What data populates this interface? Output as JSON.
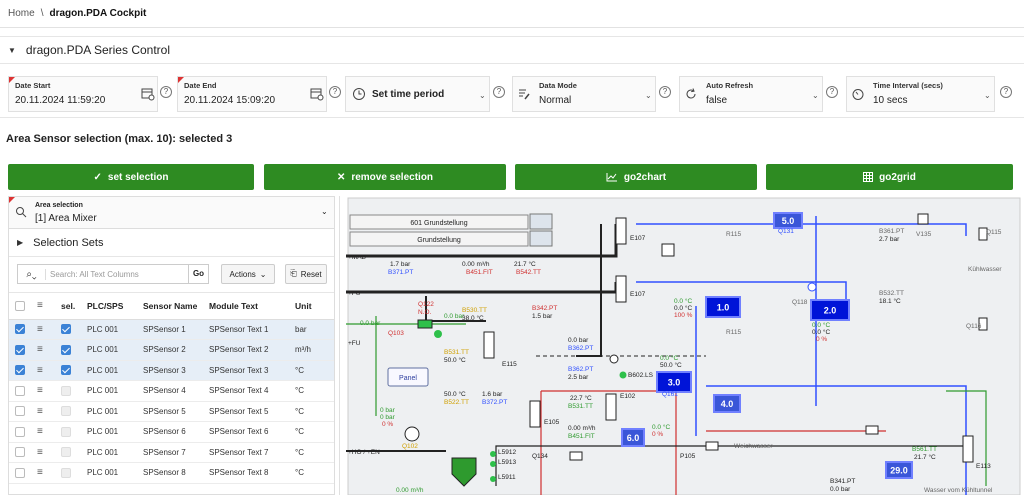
{
  "breadcrumb": {
    "home": "Home",
    "separator": "\\",
    "current": "dragon.PDA Cockpit"
  },
  "region": {
    "title": "dragon.PDA Series Control"
  },
  "filters": {
    "date_start": {
      "label": "Date Start",
      "value": "20.11.2024 11:59:20"
    },
    "date_end": {
      "label": "Date End",
      "value": "20.11.2024 15:09:20"
    },
    "time_period": {
      "value": "Set time period"
    },
    "data_mode": {
      "label": "Data Mode",
      "value": "Normal"
    },
    "auto_refresh": {
      "label": "Auto Refresh",
      "value": "false"
    },
    "time_interval": {
      "label": "Time Interval (secs)",
      "value": "10 secs"
    },
    "help": "?"
  },
  "selection": {
    "heading": "Area Sensor selection (max. 10): selected 3",
    "buttons": {
      "set": "set selection",
      "remove": "remove selection",
      "chart": "go2chart",
      "grid": "go2grid"
    },
    "area": {
      "label": "Area selection",
      "value": "[1] Area Mixer"
    },
    "sets_label": "Selection Sets",
    "search_placeholder": "Search: All Text Columns",
    "go": "Go",
    "actions": "Actions",
    "reset": "Reset",
    "columns": [
      "sel.",
      "PLC/SPS",
      "Sensor Name",
      "Module Text",
      "Unit"
    ],
    "rows": [
      {
        "plc": "PLC 001",
        "sensor": "SPSensor 1",
        "module": "SPSensor Text 1",
        "unit": "bar"
      },
      {
        "plc": "PLC 001",
        "sensor": "SPSensor 2",
        "module": "SPSensor Text 2",
        "unit": "m³/h"
      },
      {
        "plc": "PLC 001",
        "sensor": "SPSensor 3",
        "module": "SPSensor Text 3",
        "unit": "°C"
      },
      {
        "plc": "PLC 001",
        "sensor": "SPSensor 4",
        "module": "SPSensor Text 4",
        "unit": "°C"
      },
      {
        "plc": "PLC 001",
        "sensor": "SPSensor 5",
        "module": "SPSensor Text 5",
        "unit": "°C"
      },
      {
        "plc": "PLC 001",
        "sensor": "SPSensor 6",
        "module": "SPSensor Text 6",
        "unit": "°C"
      },
      {
        "plc": "PLC 001",
        "sensor": "SPSensor 7",
        "module": "SPSensor Text 7",
        "unit": "°C"
      },
      {
        "plc": "PLC 001",
        "sensor": "SPSensor 8",
        "module": "SPSensor Text 8",
        "unit": "°C"
      }
    ],
    "selected_rows": [
      0,
      1,
      2
    ]
  },
  "diagram": {
    "buttons": {
      "g601": "601 Grundstellung",
      "grund": "Grundstellung",
      "panel": "Panel"
    },
    "blue_values": [
      "5.0",
      "1.0",
      "2.0",
      "3.0",
      "4.0",
      "6.0",
      "29.0"
    ],
    "left_labels": [
      "+MAB",
      "+FU",
      "+FU",
      "+HO / +EN"
    ],
    "right_labels": [
      "Kühlwasser",
      "Weichwasser",
      "Wasser vom Kühltunnel"
    ],
    "readings": {
      "r1": "1.7 bar",
      "r1t": "B371.PT",
      "r2": "0.00 m³/h",
      "r2t": "B451.FIT",
      "r3": "21.7 °C",
      "r3t": "B542.TT",
      "r4": "2.7 bar",
      "r4t": "B361.PT",
      "r5": "18.1 °C",
      "r5t": "B532.TT",
      "r6": "0.0 bar",
      "r7": "0.0 bar",
      "r8": "38.0 °C",
      "r8t": "B530.TT",
      "r9": "1.5 bar",
      "r9t": "B342.PT",
      "r10": "50.0 °C",
      "r10t": "B531.TT",
      "r11": "0.0 bar",
      "r11t": "B362.PT",
      "r12": "2.5 bar",
      "r12t": "B362.PT",
      "r13": "0.0 °C",
      "r14": "50.0 °C",
      "r15": "50.0 °C",
      "r15t": "B522.TT",
      "r16": "1.6 bar",
      "r16t": "B372.PT",
      "r17": "22.7 °C",
      "r17t": "B531.TT",
      "r18": "0.00 m³/h",
      "r18t": "B451.FIT",
      "r19": "0.0 °C",
      "r20": "0.0 °C",
      "r21": "100 %",
      "r22": "0.0 °C",
      "r23": "0.0 °C",
      "r24": "0 %",
      "r25": "0 %",
      "r26": "0.0 °C",
      "r27": "21.7 °C",
      "r27t": "B561.TT",
      "r28": "0.00 m³/h",
      "r29": "0 bar",
      "r30": "0 bar",
      "r31": "0 %",
      "r32": "B341.PT",
      "r33": "0.0 bar"
    },
    "tags": [
      "E107",
      "E107",
      "E115",
      "E105",
      "E102",
      "E113",
      "Q131",
      "Q161",
      "Q118",
      "Q115",
      "Q116",
      "V135",
      "R115",
      "R115",
      "Q103",
      "Q122",
      "Q102",
      "Q134",
      "P105",
      "L5912",
      "L5913",
      "L5911",
      "B602.LS",
      "N.O."
    ]
  }
}
